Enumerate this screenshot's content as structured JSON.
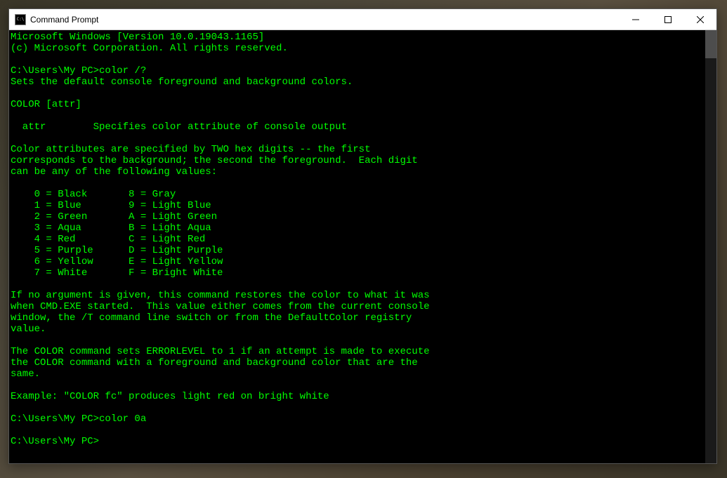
{
  "window": {
    "title": "Command Prompt"
  },
  "terminal": {
    "fg_color": "#00ff00",
    "bg_color": "#000000",
    "lines": [
      "Microsoft Windows [Version 10.0.19043.1165]",
      "(c) Microsoft Corporation. All rights reserved.",
      "",
      "C:\\Users\\My PC>color /?",
      "Sets the default console foreground and background colors.",
      "",
      "COLOR [attr]",
      "",
      "  attr        Specifies color attribute of console output",
      "",
      "Color attributes are specified by TWO hex digits -- the first",
      "corresponds to the background; the second the foreground.  Each digit",
      "can be any of the following values:",
      "",
      "    0 = Black       8 = Gray",
      "    1 = Blue        9 = Light Blue",
      "    2 = Green       A = Light Green",
      "    3 = Aqua        B = Light Aqua",
      "    4 = Red         C = Light Red",
      "    5 = Purple      D = Light Purple",
      "    6 = Yellow      E = Light Yellow",
      "    7 = White       F = Bright White",
      "",
      "If no argument is given, this command restores the color to what it was",
      "when CMD.EXE started.  This value either comes from the current console",
      "window, the /T command line switch or from the DefaultColor registry",
      "value.",
      "",
      "The COLOR command sets ERRORLEVEL to 1 if an attempt is made to execute",
      "the COLOR command with a foreground and background color that are the",
      "same.",
      "",
      "Example: \"COLOR fc\" produces light red on bright white",
      "",
      "C:\\Users\\My PC>color 0a",
      "",
      "C:\\Users\\My PC>"
    ]
  }
}
